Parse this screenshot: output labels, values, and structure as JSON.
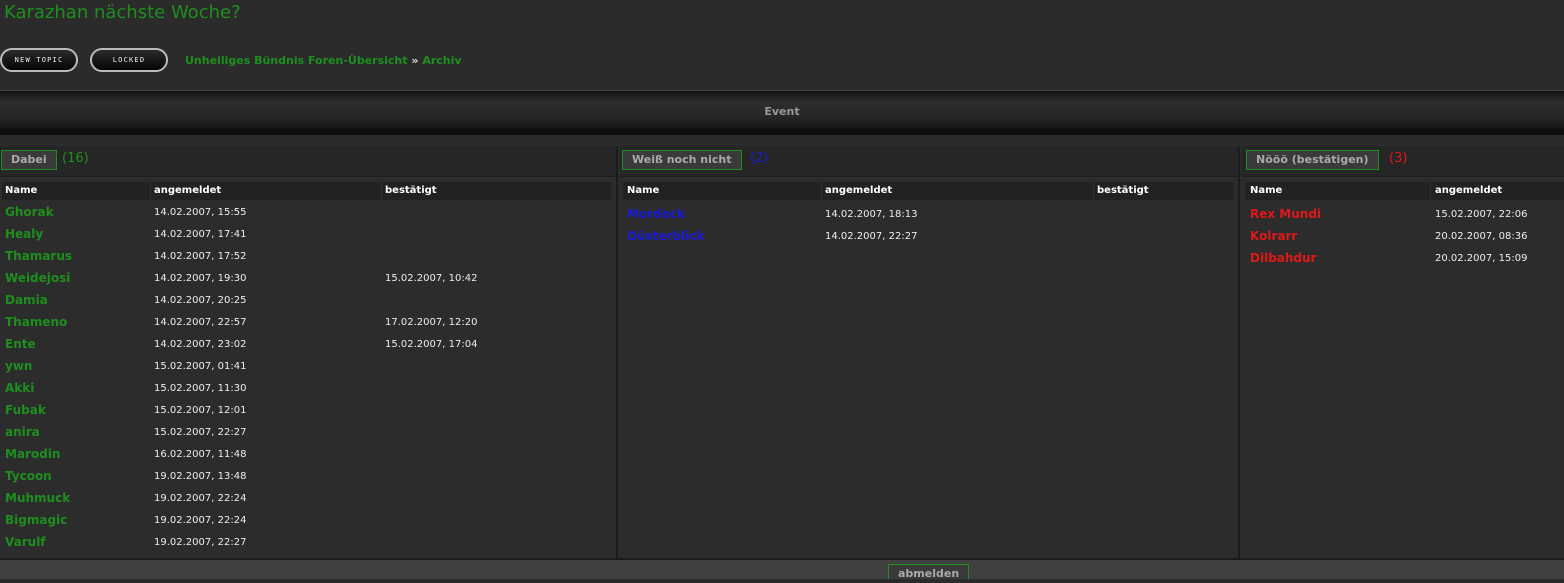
{
  "page": {
    "title": "Karazhan nächste Woche?"
  },
  "buttons": {
    "new_topic": "NEW TOPIC",
    "locked": "LOCKED"
  },
  "breadcrumb": {
    "forum": "Unheiliges Bündnis Foren-Übersicht",
    "separator": "»",
    "section": "Archiv"
  },
  "event": {
    "label": "Event"
  },
  "colors": {
    "green": "#1e8f1e",
    "blue": "#1a1ad6",
    "red": "#e01818"
  },
  "columns": [
    {
      "button": "Dabei",
      "count": "(16)",
      "headers": [
        "Name",
        "angemeldet",
        "bestätigt"
      ],
      "rows": [
        {
          "name": "Ghorak",
          "registered": "14.02.2007, 15:55",
          "confirmed": ""
        },
        {
          "name": "Healy",
          "registered": "14.02.2007, 17:41",
          "confirmed": ""
        },
        {
          "name": "Thamarus",
          "registered": "14.02.2007, 17:52",
          "confirmed": ""
        },
        {
          "name": "Weidejosi",
          "registered": "14.02.2007, 19:30",
          "confirmed": "15.02.2007, 10:42"
        },
        {
          "name": "Damia",
          "registered": "14.02.2007, 20:25",
          "confirmed": ""
        },
        {
          "name": "Thameno",
          "registered": "14.02.2007, 22:57",
          "confirmed": "17.02.2007, 12:20"
        },
        {
          "name": "Ente",
          "registered": "14.02.2007, 23:02",
          "confirmed": "15.02.2007, 17:04"
        },
        {
          "name": "ywn",
          "registered": "15.02.2007, 01:41",
          "confirmed": ""
        },
        {
          "name": "Akki",
          "registered": "15.02.2007, 11:30",
          "confirmed": ""
        },
        {
          "name": "Fubak",
          "registered": "15.02.2007, 12:01",
          "confirmed": ""
        },
        {
          "name": "anira",
          "registered": "15.02.2007, 22:27",
          "confirmed": ""
        },
        {
          "name": "Marodin",
          "registered": "16.02.2007, 11:48",
          "confirmed": ""
        },
        {
          "name": "Tycoon",
          "registered": "19.02.2007, 13:48",
          "confirmed": ""
        },
        {
          "name": "Muhmuck",
          "registered": "19.02.2007, 22:24",
          "confirmed": ""
        },
        {
          "name": "Bigmagic",
          "registered": "19.02.2007, 22:24",
          "confirmed": ""
        },
        {
          "name": "Varulf",
          "registered": "19.02.2007, 22:27",
          "confirmed": ""
        }
      ]
    },
    {
      "button": "Weiß noch nicht",
      "count": "(2)",
      "headers": [
        "Name",
        "angemeldet",
        "bestätigt"
      ],
      "rows": [
        {
          "name": "Mordock",
          "registered": "14.02.2007, 18:13",
          "confirmed": ""
        },
        {
          "name": "Düsterblick",
          "registered": "14.02.2007, 22:27",
          "confirmed": ""
        }
      ]
    },
    {
      "button": "Nööö (bestätigen)",
      "count": "(3)",
      "headers": [
        "Name",
        "angemeldet"
      ],
      "rows": [
        {
          "name": "Rex Mundi",
          "registered": "15.02.2007, 22:06"
        },
        {
          "name": "Kolrarr",
          "registered": "20.02.2007, 08:36"
        },
        {
          "name": "Dilbahdur",
          "registered": "20.02.2007, 15:09"
        }
      ]
    }
  ],
  "footer": {
    "unregister": "abmelden"
  }
}
